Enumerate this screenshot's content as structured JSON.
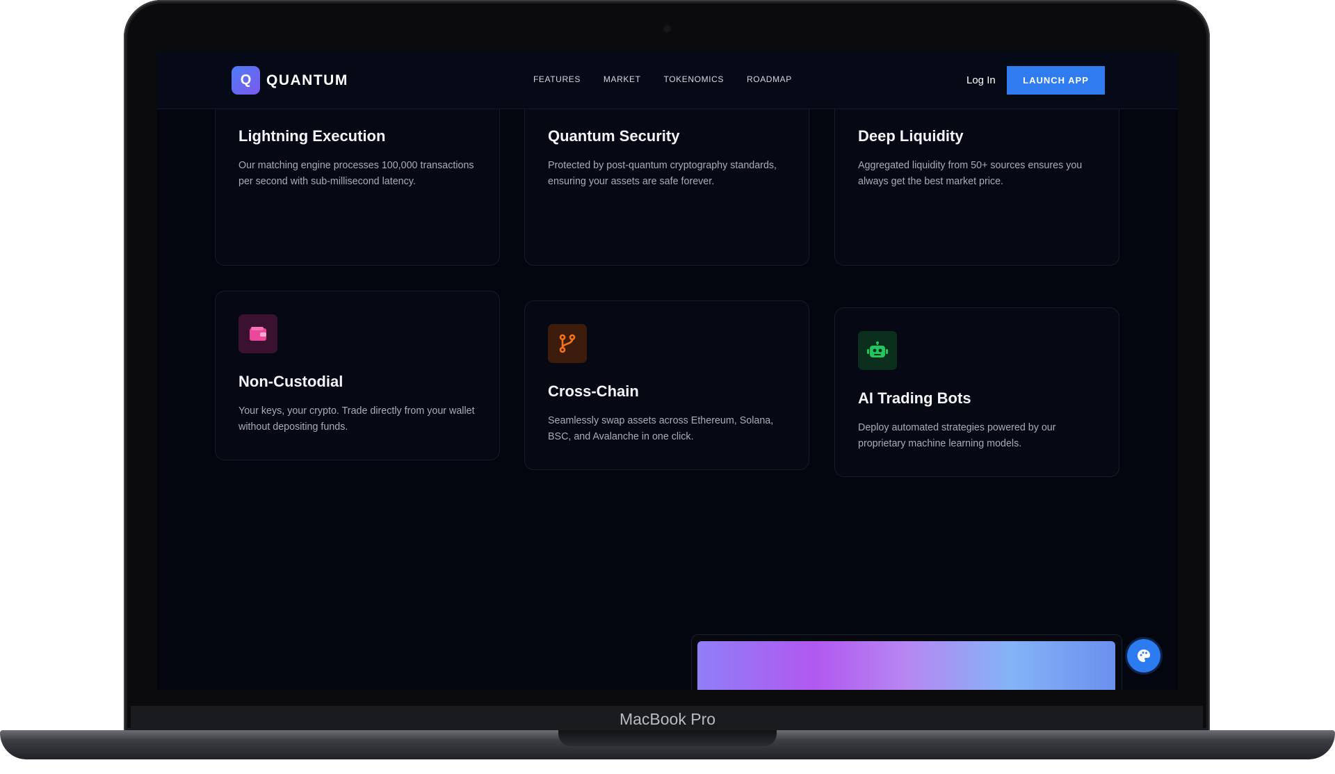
{
  "nav": {
    "logo_letter": "Q",
    "logo_text": "QUANTUM",
    "links": [
      "FEATURES",
      "MARKET",
      "TOKENOMICS",
      "ROADMAP"
    ],
    "login_label": "Log In",
    "launch_label": "LAUNCH APP"
  },
  "features": [
    {
      "icon": "lightning-icon",
      "color": "#3b82f6",
      "title": "Lightning Execution",
      "description": "Our matching engine processes 100,000 transactions per second with sub-millisecond latency."
    },
    {
      "icon": "shield-icon",
      "color": "#8b5cf6",
      "title": "Quantum Security",
      "description": "Protected by post-quantum cryptography standards, ensuring your assets are safe forever."
    },
    {
      "icon": "coins-stack-icon",
      "color": "#22b8cf",
      "title": "Deep Liquidity",
      "description": "Aggregated liquidity from 50+ sources ensures you always get the best market price."
    },
    {
      "icon": "wallet-icon",
      "color": "#ec4899",
      "title": "Non-Custodial",
      "description": "Your keys, your crypto. Trade directly from your wallet without depositing funds."
    },
    {
      "icon": "git-branch-icon",
      "color": "#f97316",
      "title": "Cross-Chain",
      "description": "Seamlessly swap assets across Ethereum, Solana, BSC, and Avalanche in one click."
    },
    {
      "icon": "robot-icon",
      "color": "#22c55e",
      "title": "AI Trading Bots",
      "description": "Deploy automated strategies powered by our proprietary machine learning models."
    }
  ],
  "device_label": "MacBook Pro",
  "fab_icon": "palette-icon",
  "accent_color": "#2f7cf0"
}
